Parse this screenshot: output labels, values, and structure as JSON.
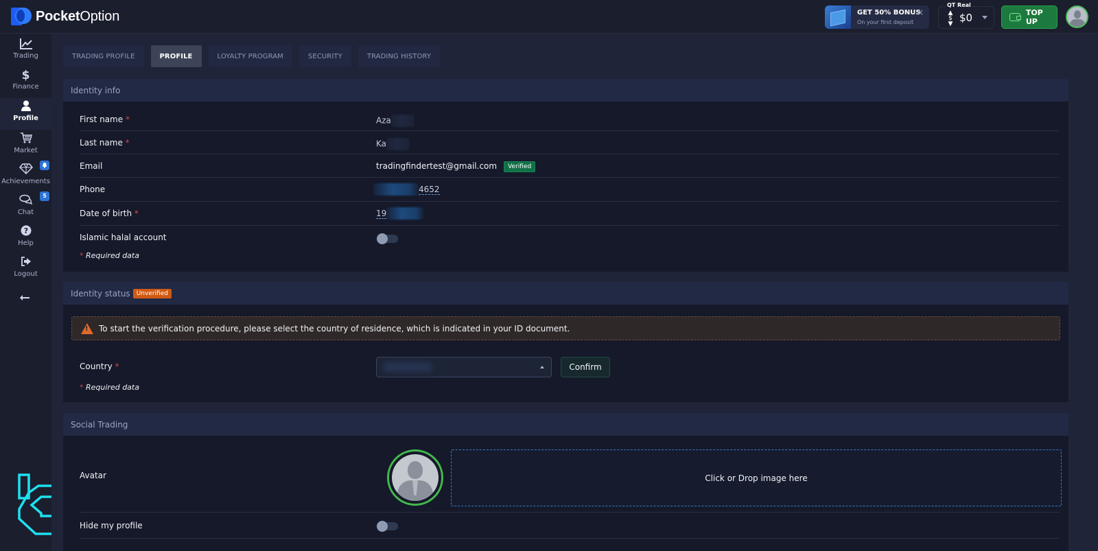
{
  "header": {
    "brand_bold": "Pocket",
    "brand_light": "Option",
    "bonus": {
      "title": "GET 50% BONUS",
      "subtitle": "On your first deposit",
      "close": "×"
    },
    "account": {
      "label": "QT Real",
      "balance": "$0",
      "icon": "$"
    },
    "topup_label": "TOP UP"
  },
  "sidebar": {
    "items": [
      {
        "label": "Trading",
        "icon": "chart-line-icon"
      },
      {
        "label": "Finance",
        "icon": "dollar-icon"
      },
      {
        "label": "Profile",
        "icon": "user-icon",
        "active": true
      },
      {
        "label": "Market",
        "icon": "cart-icon"
      },
      {
        "label": "Achievements",
        "icon": "diamond-icon",
        "badge": "🔔"
      },
      {
        "label": "Chat",
        "icon": "chat-icon",
        "badge": "5"
      },
      {
        "label": "Help",
        "icon": "help-icon"
      },
      {
        "label": "Logout",
        "icon": "logout-icon"
      }
    ],
    "collapse_icon": "arrow-left-icon"
  },
  "tabs": [
    {
      "label": "TRADING PROFILE"
    },
    {
      "label": "PROFILE",
      "active": true
    },
    {
      "label": "LOYALTY PROGRAM"
    },
    {
      "label": "SECURITY"
    },
    {
      "label": "TRADING HISTORY"
    }
  ],
  "identity_info": {
    "title": "Identity info",
    "fields": [
      {
        "label": "First name",
        "required": "*",
        "value": "Aza"
      },
      {
        "label": "Last name",
        "required": "*",
        "value": "Ka"
      },
      {
        "label": "Email",
        "value": "tradingfindertest@gmail.com",
        "badge": "Verified"
      },
      {
        "label": "Phone",
        "value": "4652"
      },
      {
        "label": "Date of birth",
        "required": "*",
        "value": "19"
      },
      {
        "label": "Islamic halal account",
        "toggle": false
      }
    ],
    "required_note": "Required data",
    "required_mark": "*"
  },
  "identity_status": {
    "title": "Identity status",
    "badge": "Unverified",
    "alert": "To start the verification procedure, please select the country of residence, which is indicated in your ID document.",
    "country_label": "Country",
    "required_mark": "*",
    "country_value": "",
    "confirm_label": "Confirm",
    "required_note": "Required data"
  },
  "social_trading": {
    "title": "Social Trading",
    "avatar_label": "Avatar",
    "dropzone_text": "Click or Drop image here",
    "hide_profile_label": "Hide my profile",
    "hide_profile": false
  },
  "colors": {
    "accent_green": "#1d7a3e",
    "verified_green": "#107046",
    "unverified_orange": "#d05a14",
    "badge_blue": "#2d74d8",
    "required_red": "#d6434b"
  }
}
